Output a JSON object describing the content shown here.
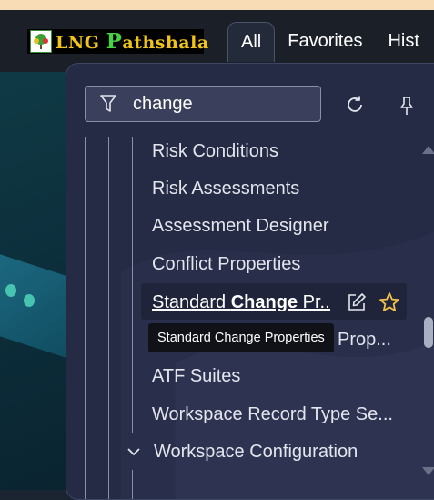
{
  "logo": {
    "letter_p": "P",
    "text_a": "LNG ",
    "text_b": "athshala"
  },
  "tabs": [
    {
      "label": "All"
    },
    {
      "label": "Favorites"
    },
    {
      "label": "Hist"
    }
  ],
  "filter": {
    "value": "change"
  },
  "menu_items": [
    {
      "label": "Risk Conditions"
    },
    {
      "label": "Risk Assessments"
    },
    {
      "label": "Assessment Designer"
    },
    {
      "label": "Conflict Properties"
    },
    {
      "label": "Prop..."
    },
    {
      "label": "ATF Suites"
    },
    {
      "label": "Workspace Record Type Se..."
    }
  ],
  "highlighted": {
    "label_pre": "Standard ",
    "label_bold": "Change",
    "label_post": " Pr..."
  },
  "tooltip": "Standard Change Properties",
  "section": {
    "label": "Workspace Configuration"
  },
  "colors": {
    "accent_star": "#f0c14b",
    "menu_bg": "#262b45",
    "logo_green": "#47d147",
    "logo_yellow": "#f0c419"
  }
}
